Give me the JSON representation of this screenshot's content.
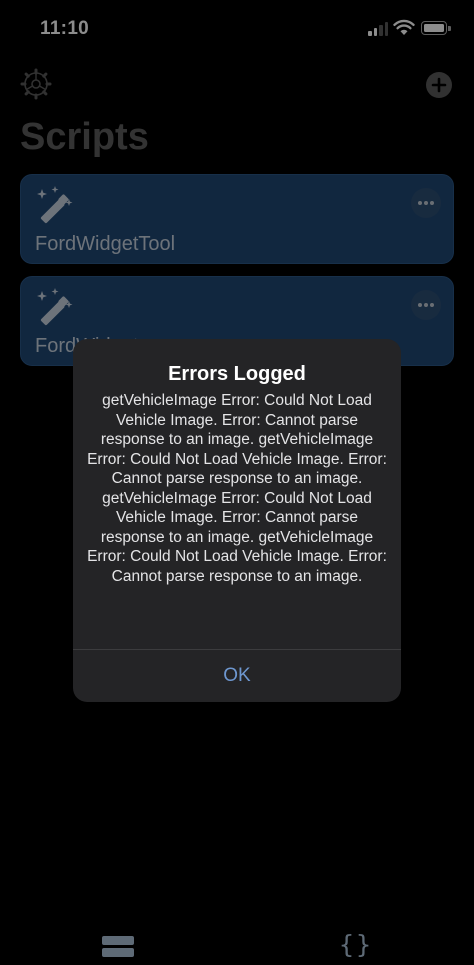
{
  "status_bar": {
    "time": "11:10"
  },
  "header": {
    "title": "Scripts"
  },
  "icons": {
    "settings": "gear-icon",
    "add": "plus-circle-icon",
    "script": "magic-wand-icon",
    "more": "ellipsis-icon",
    "tab_scripts": "stack-icon",
    "tab_code": "braces-icon"
  },
  "scripts": [
    {
      "name": "FordWidgetTool"
    },
    {
      "name": "FordWidget"
    }
  ],
  "alert": {
    "title": "Errors Logged",
    "message": "getVehicleImage Error: Could Not Load Vehicle Image. Error: Cannot parse response to an image. getVehicleImage Error: Could Not Load Vehicle Image. Error: Cannot parse response to an image. getVehicleImage Error: Could Not Load Vehicle Image. Error: Cannot parse response to an image. getVehicleImage Error: Could Not Load Vehicle Image. Error: Cannot parse response to an image.",
    "button": "OK"
  },
  "bottom_bar": {
    "code_tab_glyph": "{}"
  },
  "colors": {
    "background": "#000000",
    "card": "#1f4774",
    "alert": "#242426",
    "accent": "#6e97cf"
  }
}
